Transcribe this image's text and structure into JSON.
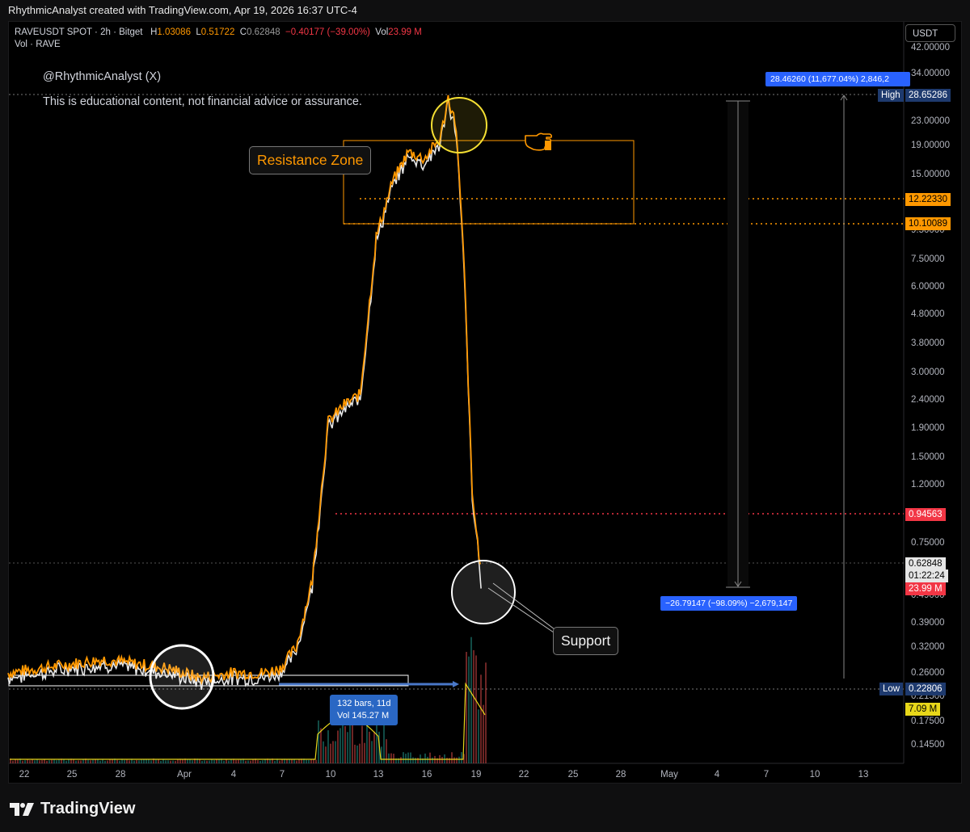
{
  "header": {
    "created_by": "RhythmicAnalyst created with TradingView.com, Apr 19, 2026 16:37 UTC-4"
  },
  "legend": {
    "symbol": "RAVEUSDT SPOT · 2h · Bitget",
    "high_label": "H",
    "high": "1.03086",
    "low_label": "L",
    "low": "0.51722",
    "close_label": "C",
    "close": "0.62848",
    "change": "−0.40177 (−39.00%)",
    "vol_label": "Vol",
    "vol": "23.99 M",
    "sub": "Vol · RAVE"
  },
  "annotations": {
    "author": "@RhythmicAnalyst (X)",
    "disclaimer": "This is educational content, not financial advice or assurance.",
    "resistance": "Resistance Zone",
    "support": "Support",
    "range_bars": "132 bars, 11d",
    "range_vol": "Vol 145.27 M",
    "measure_up": "28.46260 (11,677.04%) 2,846,2",
    "measure_down": "−26.79147 (−98.09%) −2,679,147"
  },
  "price_axis": {
    "currency": "USDT",
    "ticks": [
      "42.00000",
      "34.00000",
      "23.00000",
      "19.00000",
      "15.00000",
      "9.50000",
      "7.50000",
      "6.00000",
      "4.80000",
      "3.80000",
      "3.00000",
      "2.40000",
      "1.90000",
      "1.50000",
      "1.20000",
      "0.75000",
      "0.49000",
      "0.39000",
      "0.32000",
      "0.26000",
      "0.21500",
      "0.17500",
      "0.14500"
    ],
    "high_label": "High",
    "high_value": "28.65286",
    "low_label": "Low",
    "low_value": "0.22806",
    "level_1": "12.22330",
    "level_2": "10.10089",
    "level_3": "0.94563",
    "last_price": "0.62848",
    "countdown": "01:22:24",
    "volume_last": "23.99 M",
    "volume_ma": "7.09 M"
  },
  "time_axis": {
    "ticks": [
      "22",
      "25",
      "28",
      "Apr",
      "4",
      "7",
      "10",
      "13",
      "16",
      "19",
      "22",
      "25",
      "28",
      "May",
      "4",
      "7",
      "10",
      "13"
    ]
  },
  "brand": {
    "name": "TradingView"
  },
  "colors": {
    "price_line": "#ff9800",
    "secondary_line": "#e6e6e6",
    "resistance": "#ff9800",
    "support_level": "#f23645",
    "measure": "#2962ff",
    "volume_ma": "#e8d71a",
    "highlight": "#f5e033"
  },
  "chart_data": {
    "type": "line",
    "symbol": "RAVEUSDT",
    "interval": "2h",
    "scale": "log",
    "y_unit": "USDT",
    "ylim": [
      0.13,
      46
    ],
    "xlim": [
      "Mar 21",
      "May 15"
    ],
    "x": [
      "Mar 21",
      "Mar 23",
      "Mar 25",
      "Mar 27",
      "Mar 29",
      "Mar 31",
      "Apr 2",
      "Apr 4",
      "Apr 6",
      "Apr 7",
      "Apr 8",
      "Apr 9",
      "Apr 10",
      "Apr 11",
      "Apr 12",
      "Apr 13",
      "Apr 14",
      "Apr 15",
      "Apr 16",
      "Apr 17",
      "Apr 17.5",
      "Apr 18",
      "Apr 18.5",
      "Apr 19",
      "Apr 19.5"
    ],
    "series": [
      {
        "name": "RAVEUSDT",
        "values": [
          0.26,
          0.27,
          0.28,
          0.29,
          0.28,
          0.27,
          0.25,
          0.26,
          0.26,
          0.27,
          0.32,
          0.55,
          2.0,
          2.3,
          2.5,
          9.0,
          14.0,
          18.0,
          17.0,
          20.0,
          28.0,
          22.0,
          7.0,
          1.1,
          0.63
        ]
      }
    ],
    "levels": [
      {
        "label": "Resistance Zone",
        "from": 10.10089,
        "to": 20.0
      },
      {
        "value": 12.2233
      },
      {
        "value": 0.94563
      }
    ],
    "high": 28.65286,
    "low": 0.22806,
    "last": 0.62848,
    "grid": false,
    "legend": "top-left"
  }
}
